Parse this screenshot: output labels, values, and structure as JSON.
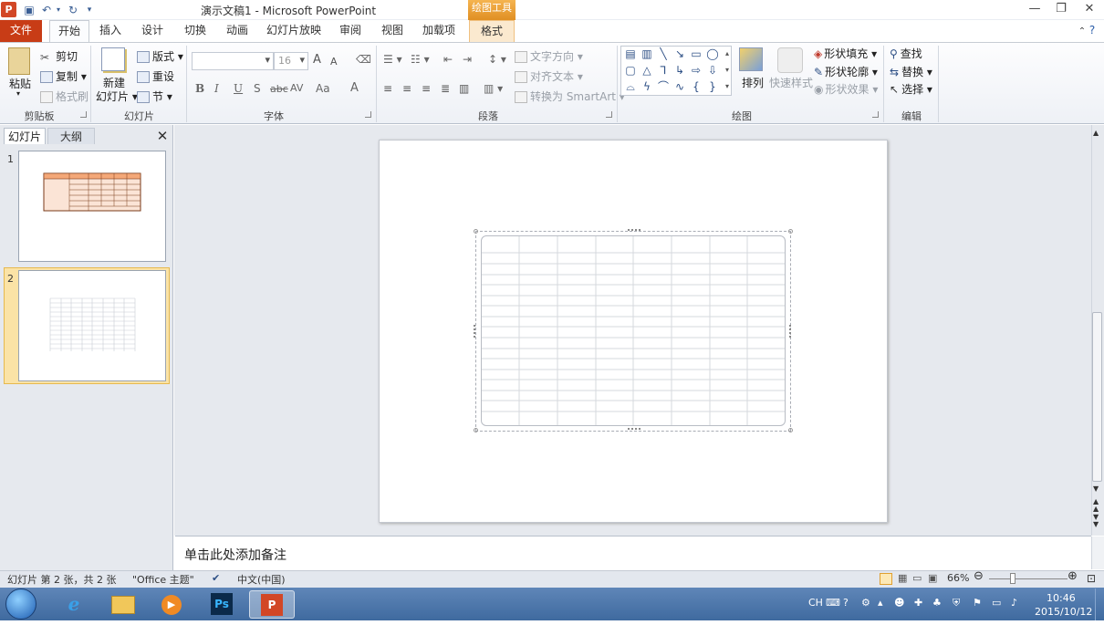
{
  "app": {
    "icon_letter": "P",
    "document_title": "演示文稿1 - Microsoft PowerPoint",
    "context_tools_label": "绘图工具"
  },
  "quick_access": {
    "save_icon": "save-icon",
    "undo_icon": "undo-icon",
    "redo_icon": "redo-icon",
    "customize_icon": "customize-icon"
  },
  "window_buttons": {
    "minimize": "—",
    "restore": "❐",
    "close": "✕"
  },
  "tabs": [
    {
      "label": "文件"
    },
    {
      "label": "开始"
    },
    {
      "label": "插入"
    },
    {
      "label": "设计"
    },
    {
      "label": "切换"
    },
    {
      "label": "动画"
    },
    {
      "label": "幻灯片放映"
    },
    {
      "label": "审阅"
    },
    {
      "label": "视图"
    },
    {
      "label": "加载项"
    },
    {
      "label": "格式"
    }
  ],
  "ribbon": {
    "clipboard": {
      "paste": "粘贴",
      "cut": "剪切",
      "copy": "复制",
      "format_painter": "格式刷",
      "group": "剪贴板"
    },
    "slides": {
      "new_slide_line1": "新建",
      "new_slide_line2": "幻灯片",
      "layout": "版式",
      "reset": "重设",
      "section": "节",
      "group": "幻灯片"
    },
    "font": {
      "font_name": "",
      "font_size": "16",
      "group": "字体",
      "buttons": [
        "A",
        "A",
        "B",
        "I",
        "U",
        "S",
        "abc",
        "AV",
        "Aa",
        "A"
      ]
    },
    "paragraph": {
      "text_direction": "文字方向",
      "align_text": "对齐文本",
      "convert_smartart": "转换为 SmartArt",
      "group": "段落"
    },
    "drawing": {
      "arrange": "排列",
      "quick_styles": "快速样式",
      "shape_fill": "形状填充",
      "shape_outline": "形状轮廓",
      "shape_effects": "形状效果",
      "group": "绘图"
    },
    "editing": {
      "find": "查找",
      "replace": "替换",
      "select": "选择",
      "group": "编辑"
    }
  },
  "panel": {
    "tab_slides": "幻灯片",
    "tab_outline": "大纲",
    "close": "✕",
    "slide_numbers": [
      "1",
      "2"
    ]
  },
  "notes": {
    "placeholder": "单击此处添加备注"
  },
  "status": {
    "slide_info": "幻灯片 第 2 张，共 2 张",
    "theme": "\"Office 主题\"",
    "language": "中文(中国)",
    "zoom": "66%"
  },
  "taskbar": {
    "tray_lang": "CH",
    "time": "10:46",
    "date": "2015/10/12"
  },
  "colors": {
    "file_tab": "#c83c16",
    "context_tab": "#f0a030",
    "taskbar": "#4a76ab"
  }
}
